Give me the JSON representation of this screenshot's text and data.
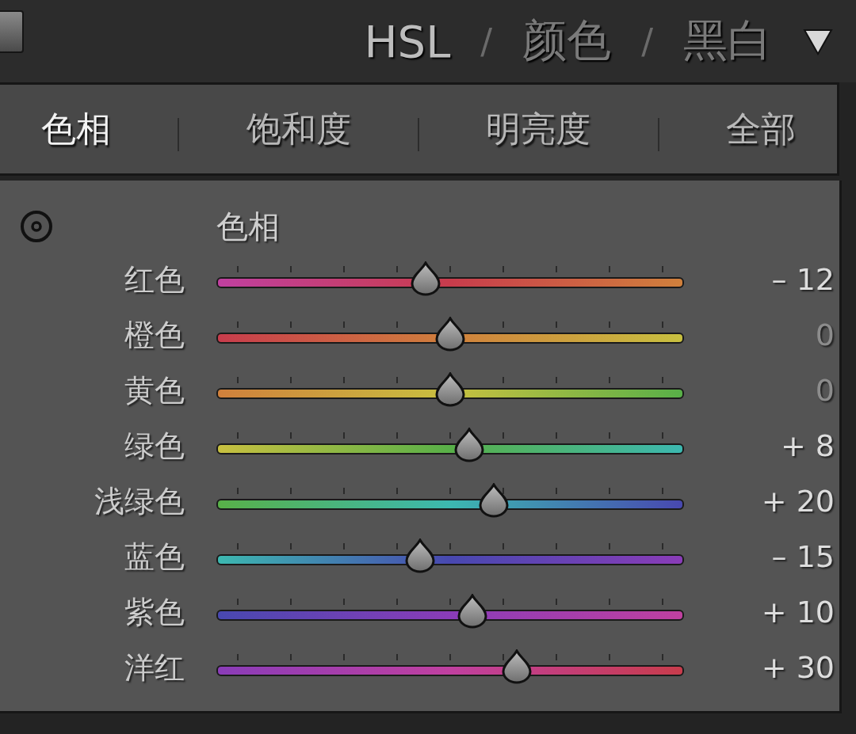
{
  "modes": [
    {
      "label": "HSL",
      "selected": true
    },
    {
      "label": "颜色",
      "selected": false
    },
    {
      "label": "黑白",
      "selected": false
    }
  ],
  "mode_separators": [
    "/",
    "/"
  ],
  "tabs": [
    {
      "label": "色相",
      "selected": true
    },
    {
      "label": "饱和度",
      "selected": false
    },
    {
      "label": "明亮度",
      "selected": false
    },
    {
      "label": "全部",
      "selected": false
    }
  ],
  "section_title": "色相",
  "sliders": [
    {
      "name": "红色",
      "level": 0.448,
      "reading": "– 12",
      "color": "#c83c4c"
    },
    {
      "name": "橙色",
      "level": 0.5,
      "reading": "0",
      "color": "#d0803c"
    },
    {
      "name": "黄色",
      "level": 0.5,
      "reading": "0",
      "color": "#c8c040"
    },
    {
      "name": "绿色",
      "level": 0.54,
      "reading": "+ 8",
      "color": "#58b048"
    },
    {
      "name": "浅绿色",
      "level": 0.593,
      "reading": "+ 20",
      "color": "#3cb8b0"
    },
    {
      "name": "蓝色",
      "level": 0.435,
      "reading": "– 15",
      "color": "#4848b0"
    },
    {
      "name": "紫色",
      "level": 0.547,
      "reading": "+ 10",
      "color": "#8a3cb8"
    },
    {
      "name": "洋红",
      "level": 0.642,
      "reading": "+ 30",
      "color": "#c040a0"
    }
  ]
}
